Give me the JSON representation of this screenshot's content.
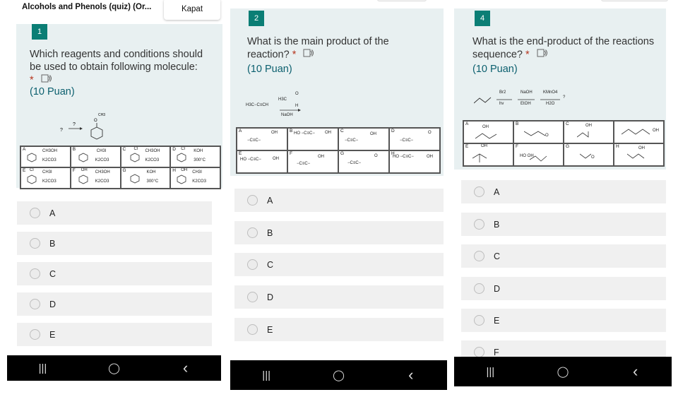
{
  "header": {
    "quiz_title": "Alcohols and Phenols (quiz) (Or...",
    "close_label": "Kapat"
  },
  "questions": [
    {
      "number": "1",
      "text": "Which reagents and conditions should be used to obtain following molecule:",
      "required_mark": "*",
      "points": "(10 Puan)",
      "scheme_labels": [
        "?",
        "?",
        "O",
        "CH3"
      ],
      "choice_cells": [
        {
          "letter": "A",
          "reagent": "CH3OH",
          "cond": "K2CO3"
        },
        {
          "letter": "B",
          "reagent": "CH3I",
          "cond": "K2CO3"
        },
        {
          "letter": "C",
          "reagent": "CH3OH",
          "cond": "K2CO3",
          "sub": "Cl"
        },
        {
          "letter": "D",
          "reagent": "KOH",
          "cond": "300°C",
          "sub": "Cl"
        },
        {
          "letter": "E",
          "reagent": "CH3I",
          "cond": "K2CO3",
          "sub": "Cl"
        },
        {
          "letter": "F",
          "reagent": "CH3OH",
          "cond": "K2CO3",
          "sub": "OH"
        },
        {
          "letter": "G",
          "reagent": "KOH",
          "cond": "300°C"
        },
        {
          "letter": "H",
          "reagent": "CH3I",
          "cond": "K2CO3",
          "sub": "OH"
        }
      ],
      "options": [
        "A",
        "B",
        "C",
        "D",
        "E"
      ]
    },
    {
      "number": "2",
      "text": "What is the main product of the reaction?",
      "required_mark": "*",
      "points": "(10 Puan)",
      "scheme_labels": [
        "H3C−C≡CH",
        "H3C",
        "O",
        "H",
        "NaOH"
      ],
      "choice_cells": [
        {
          "letter": "A",
          "formula": "−C≡C−",
          "group": "OH"
        },
        {
          "letter": "B",
          "formula": "HO −C≡C−",
          "group": "OH"
        },
        {
          "letter": "C",
          "formula": "−C≡C−",
          "group": "OH"
        },
        {
          "letter": "D",
          "formula": "−C≡C−",
          "group": "O"
        },
        {
          "letter": "E",
          "formula": "HO −C≡C−",
          "group": "OH"
        },
        {
          "letter": "F",
          "formula": "−C≡C−",
          "group": "OH"
        },
        {
          "letter": "G",
          "formula": "−C≡C−",
          "group": "O"
        },
        {
          "letter": "H",
          "formula": "HO −C≡C−",
          "group": "OH"
        }
      ],
      "options": [
        "A",
        "B",
        "C",
        "D",
        "E"
      ]
    },
    {
      "number": "4",
      "text": "What is the end-product of the reactions sequence?",
      "required_mark": "*",
      "points": "(10 Puan)",
      "scheme_labels": [
        "Br2",
        "hv",
        "NaOH",
        "EtOH",
        "KMnO4",
        "H2O",
        "?"
      ],
      "choice_cells": [
        {
          "letter": "A",
          "group": "OH"
        },
        {
          "letter": "B",
          "group": "O"
        },
        {
          "letter": "C",
          "group": "OH"
        },
        {
          "letter": "",
          "group": "OH"
        },
        {
          "letter": "E",
          "group": "OH"
        },
        {
          "letter": "F",
          "group": "HO OH"
        },
        {
          "letter": "G",
          "group": "O"
        },
        {
          "letter": "H",
          "group": "OH"
        }
      ],
      "options": [
        "A",
        "B",
        "C",
        "D",
        "E",
        "F"
      ]
    }
  ],
  "navbar": {
    "recents": "|||",
    "home": "◯",
    "back": "‹"
  }
}
